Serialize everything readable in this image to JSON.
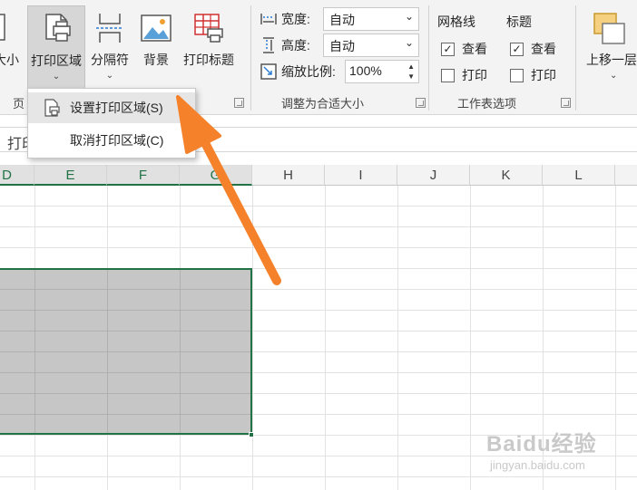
{
  "ribbon": {
    "page_setup": {
      "size_label": "大小",
      "print_area_label": "打印区域",
      "breaks_label": "分隔符",
      "background_label": "背景",
      "print_titles_label": "打印标题",
      "group_label_partial": "页"
    },
    "scale_to_fit": {
      "width_label": "宽度:",
      "width_value": "自动",
      "height_label": "高度:",
      "height_value": "自动",
      "scale_label": "缩放比例:",
      "scale_value": "100%",
      "group_label": "调整为合适大小"
    },
    "sheet_options": {
      "gridlines_label": "网格线",
      "gridlines_view_label": "查看",
      "gridlines_view_checked": true,
      "gridlines_print_label": "打印",
      "gridlines_print_checked": false,
      "headings_label": "标题",
      "headings_view_label": "查看",
      "headings_view_checked": true,
      "headings_print_label": "打印",
      "headings_print_checked": false,
      "group_label": "工作表选项"
    },
    "arrange": {
      "bring_forward_label": "上移一层"
    }
  },
  "print_area_menu": {
    "items": [
      {
        "label": "设置打印区域(S)",
        "hotkey": "S"
      },
      {
        "label": "取消打印区域(C)",
        "hotkey": "C"
      }
    ]
  },
  "formula_bar": {
    "text": "打印"
  },
  "grid": {
    "columns": [
      "D",
      "E",
      "F",
      "G",
      "H",
      "I",
      "J",
      "K",
      "L"
    ],
    "selected_columns": [
      "D",
      "E",
      "F",
      "G"
    ]
  },
  "colors": {
    "excel_green": "#217346",
    "selection_fill": "#c6c6c6",
    "arrow_orange": "#f5822a"
  },
  "watermark": {
    "main": "Baidu经验",
    "sub": "jingyan.baidu.com"
  }
}
